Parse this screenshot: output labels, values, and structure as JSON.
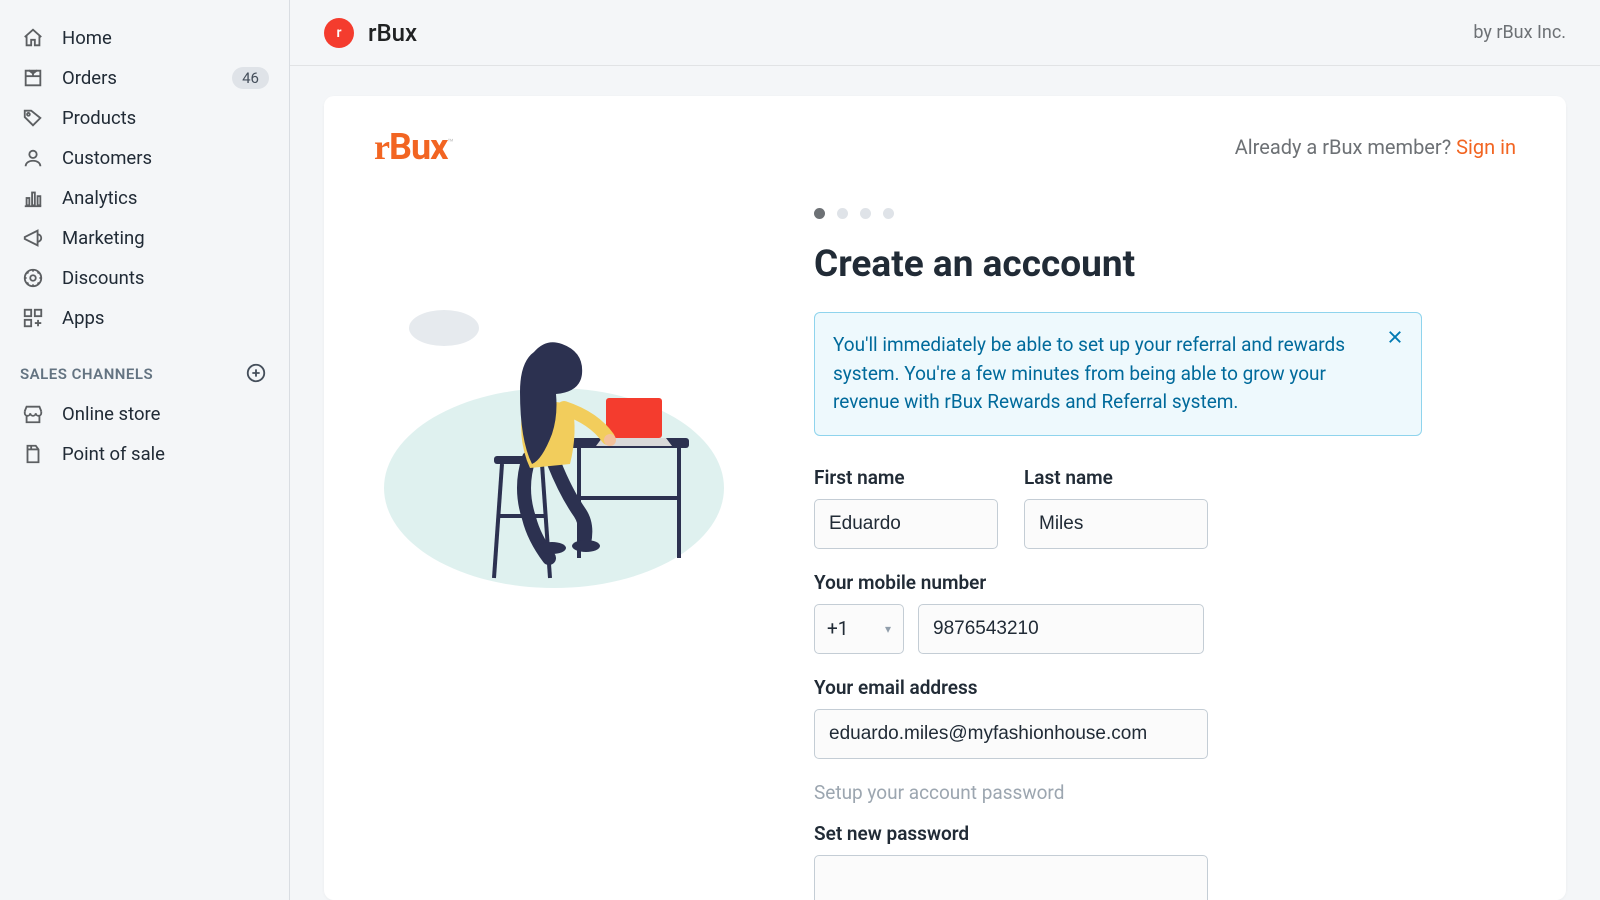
{
  "sidebar": {
    "items": [
      {
        "label": "Home",
        "icon": "home-icon"
      },
      {
        "label": "Orders",
        "icon": "orders-icon",
        "badge": "46"
      },
      {
        "label": "Products",
        "icon": "products-icon"
      },
      {
        "label": "Customers",
        "icon": "customers-icon"
      },
      {
        "label": "Analytics",
        "icon": "analytics-icon"
      },
      {
        "label": "Marketing",
        "icon": "marketing-icon"
      },
      {
        "label": "Discounts",
        "icon": "discounts-icon"
      },
      {
        "label": "Apps",
        "icon": "apps-icon"
      }
    ],
    "section_title": "SALES CHANNELS",
    "channels": [
      {
        "label": "Online store",
        "icon": "online-store-icon"
      },
      {
        "label": "Point of sale",
        "icon": "pos-icon"
      }
    ]
  },
  "topbar": {
    "brand_badge": "r",
    "brand_name": "rBux",
    "by_text": "by rBux Inc."
  },
  "card": {
    "logo_text": "rBux",
    "logo_tm": "™",
    "member_text": "Already a rBux member? ",
    "signin": "Sign in",
    "title": "Create an acccount",
    "info": "You'll immediately be able to set up your referral and rewards system. You're a few minutes from being able to grow your revenue with rBux Rewards and Referral system.",
    "labels": {
      "first_name": "First name",
      "last_name": "Last name",
      "mobile": "Your mobile number",
      "email": "Your email address",
      "password_section": "Setup your account password",
      "set_password": "Set new password"
    },
    "values": {
      "first_name": "Eduardo",
      "last_name": "Miles",
      "phone_code": "+1",
      "phone": "9876543210",
      "email": "eduardo.miles@myfashionhouse.com",
      "password": ""
    }
  }
}
